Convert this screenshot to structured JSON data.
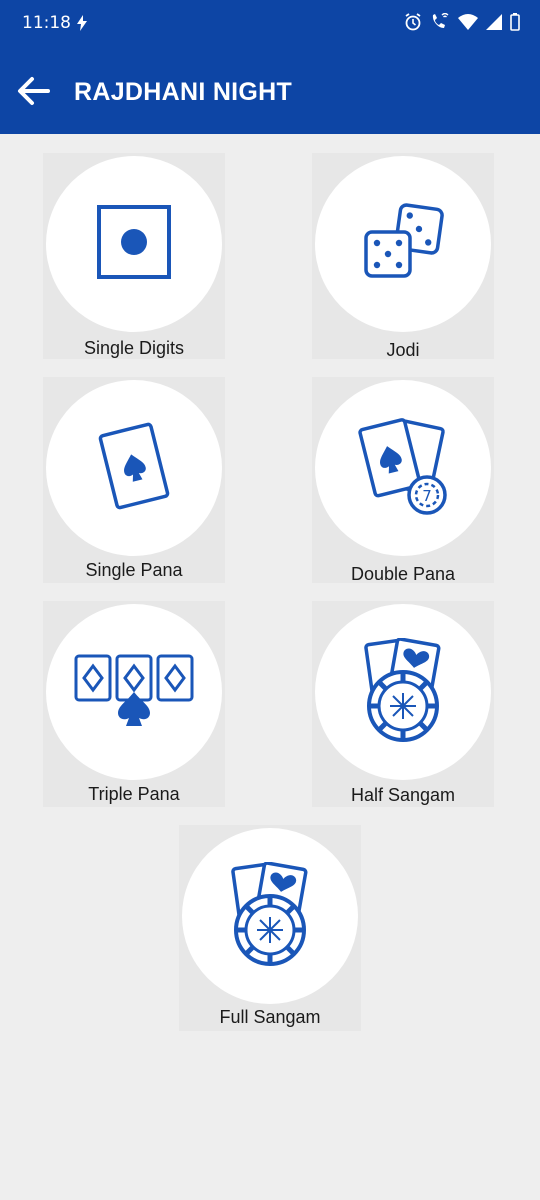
{
  "status_bar": {
    "time": "11:18",
    "icons": [
      "bolt-icon",
      "alarm-icon",
      "wifi-call-icon",
      "wifi-icon",
      "signal-icon",
      "battery-icon"
    ]
  },
  "app_bar": {
    "title": "RAJDHANI NIGHT",
    "back_icon": "arrow-left-icon"
  },
  "games": [
    {
      "label": "Single Digits",
      "icon": "single-die-icon"
    },
    {
      "label": "Jodi",
      "icon": "two-dice-icon"
    },
    {
      "label": "Single Pana",
      "icon": "single-card-spade-icon"
    },
    {
      "label": "Double Pana",
      "icon": "double-card-chip-icon"
    },
    {
      "label": "Triple Pana",
      "icon": "triple-cards-spade-icon"
    },
    {
      "label": "Half Sangam",
      "icon": "cards-chip-icon"
    },
    {
      "label": "Full Sangam",
      "icon": "cards-chip-icon"
    }
  ],
  "colors": {
    "primary": "#0d45a5",
    "icon": "#1a56b8",
    "background": "#eeeeee",
    "tile": "#e7e7e7"
  }
}
